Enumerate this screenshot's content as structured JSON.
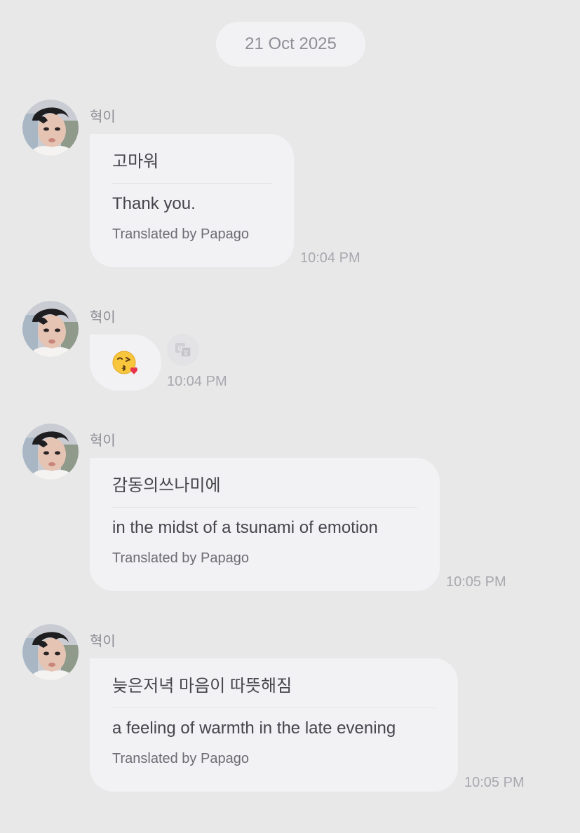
{
  "date_label": "21 Oct 2025",
  "messages": [
    {
      "sender": "혁이",
      "original": "고마워",
      "translation": "Thank you.",
      "translated_by": "Translated by Papago",
      "time": "10:04 PM"
    },
    {
      "sender": "혁이",
      "emoji": "kissing-face-with-heart",
      "time": "10:04 PM",
      "translate_icon": "translate-icon"
    },
    {
      "sender": "혁이",
      "original": "감동의쓰나미에",
      "translation": "in the midst of a tsunami of emotion",
      "translated_by": "Translated by Papago",
      "time": "10:05 PM"
    },
    {
      "sender": "혁이",
      "original": "늦은저녁 마음이 따뜻해짐",
      "translation": "a feeling of warmth in the late evening",
      "translated_by": "Translated by Papago",
      "time": "10:05 PM"
    }
  ],
  "colors": {
    "background": "#e8e8e9",
    "bubble": "#f2f2f4",
    "timestamp": "#a8a8ae"
  }
}
